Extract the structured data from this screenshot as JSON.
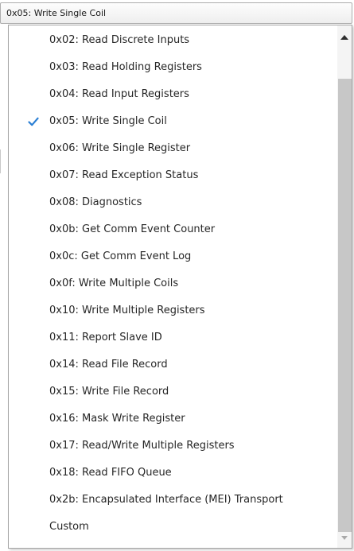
{
  "combo": {
    "selected_value": "0x05: Write Single Coil"
  },
  "dropdown": {
    "items": [
      {
        "label": "0x02: Read Discrete Inputs"
      },
      {
        "label": "0x03: Read Holding Registers"
      },
      {
        "label": "0x04: Read Input Registers"
      },
      {
        "label": "0x05: Write Single Coil"
      },
      {
        "label": "0x06: Write Single Register"
      },
      {
        "label": "0x07: Read Exception Status"
      },
      {
        "label": "0x08: Diagnostics"
      },
      {
        "label": "0x0b: Get Comm Event Counter"
      },
      {
        "label": "0x0c: Get Comm Event Log"
      },
      {
        "label": "0x0f: Write Multiple Coils"
      },
      {
        "label": "0x10: Write Multiple Registers"
      },
      {
        "label": "0x11: Report Slave ID"
      },
      {
        "label": "0x14: Read File Record"
      },
      {
        "label": "0x15: Write File Record"
      },
      {
        "label": "0x16: Mask Write Register"
      },
      {
        "label": "0x17: Read/Write Multiple Registers"
      },
      {
        "label": "0x18: Read FIFO Queue"
      },
      {
        "label": "0x2b: Encapsulated Interface (MEI) Transport"
      },
      {
        "label": "Custom"
      }
    ],
    "checked_index": 3,
    "check_icon": "checkmark-icon",
    "check_color": "#2a7fd4"
  },
  "scrollbar": {
    "up_icon": "scroll-up-arrow-icon",
    "down_icon": "scroll-down-arrow-icon",
    "down_enabled": false
  },
  "colors": {
    "popup_border": "#a4a4a4",
    "scroll_thumb": "#c7c7c7",
    "scroll_track": "#f4f4f4"
  }
}
